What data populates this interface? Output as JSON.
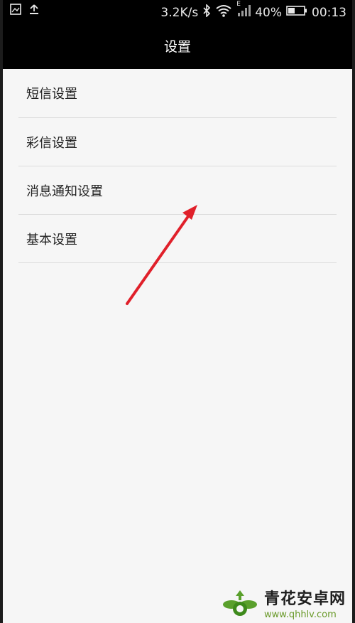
{
  "status_bar": {
    "speed": "3.2K/s",
    "network_type": "E",
    "battery": "40%",
    "time": "00:13",
    "icons": [
      "image-icon",
      "upload-icon",
      "bluetooth-icon",
      "wifi-icon",
      "signal-icon",
      "battery-icon"
    ]
  },
  "header": {
    "title": "设置"
  },
  "settings": {
    "items": [
      {
        "label": "短信设置"
      },
      {
        "label": "彩信设置"
      },
      {
        "label": "消息通知设置"
      },
      {
        "label": "基本设置"
      }
    ]
  },
  "annotation": {
    "arrow_color": "#e0202a"
  },
  "watermark": {
    "title": "青花安卓网",
    "url": "www.qhhlv.com",
    "accent": "#5aa02c"
  }
}
